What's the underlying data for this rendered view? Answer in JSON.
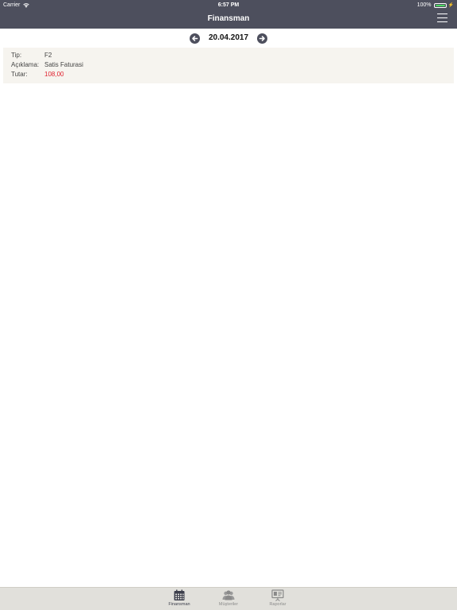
{
  "status_bar": {
    "carrier": "Carrier",
    "time": "6:57 PM",
    "battery": "100%",
    "battery_color": "#4cd964"
  },
  "nav": {
    "title": "Finansman",
    "menu_icon": "hamburger-menu-icon"
  },
  "date_nav": {
    "date": "20.04.2017",
    "prev_icon": "arrow-left-circle-icon",
    "next_icon": "arrow-right-circle-icon"
  },
  "record": {
    "fields": [
      {
        "label": "Tip:",
        "value": "F2"
      },
      {
        "label": "Açıklama:",
        "value": "Satis Faturasi"
      },
      {
        "label": "Tutar:",
        "value": "108,00"
      }
    ],
    "amount_color": "#e0212f"
  },
  "tabs": [
    {
      "label": "Finansman",
      "icon": "calendar-icon",
      "active": true
    },
    {
      "label": "Müşteriler",
      "icon": "users-icon",
      "active": false
    },
    {
      "label": "Raporlar",
      "icon": "presentation-board-icon",
      "active": false
    }
  ],
  "colors": {
    "header_bg": "#4d4f5d",
    "card_bg": "#f6f4ef",
    "tabbar_bg": "#e1e0db"
  }
}
